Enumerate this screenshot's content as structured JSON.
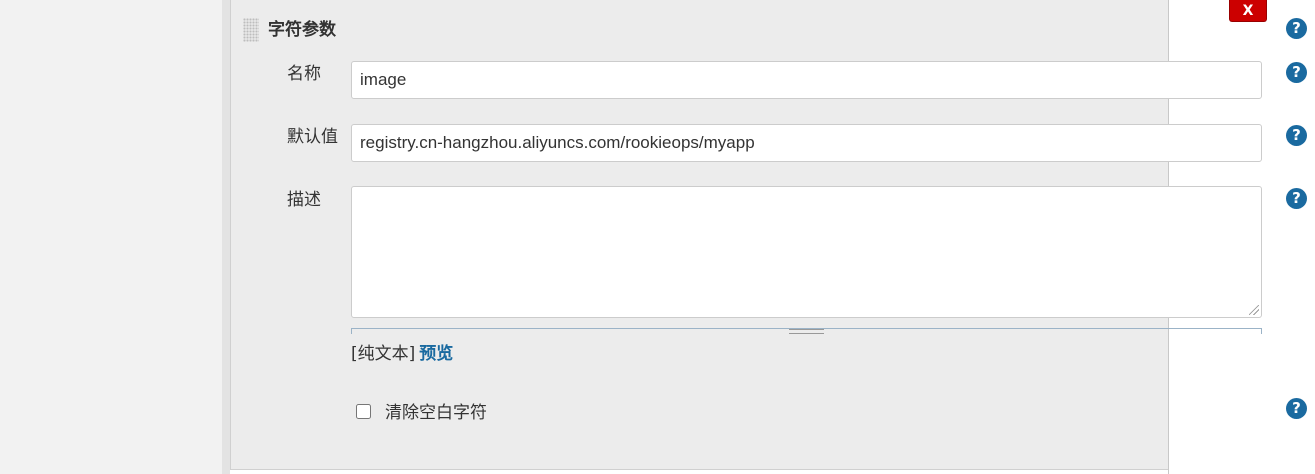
{
  "section": {
    "title": "字符参数",
    "delete_label": "X"
  },
  "fields": {
    "name": {
      "label": "名称",
      "value": "image"
    },
    "default_value": {
      "label": "默认值",
      "value": "registry.cn-hangzhou.aliyuncs.com/rookieops/myapp"
    },
    "description": {
      "label": "描述",
      "value": ""
    }
  },
  "syntax": {
    "plain_text": "[纯文本]",
    "preview": "预览"
  },
  "trim": {
    "label": "清除空白字符",
    "checked": false
  },
  "help": {
    "glyph": "?"
  },
  "colors": {
    "help_blue": "#1a6aa0",
    "delete_red": "#cc0000",
    "panel_bg": "#ececec"
  }
}
